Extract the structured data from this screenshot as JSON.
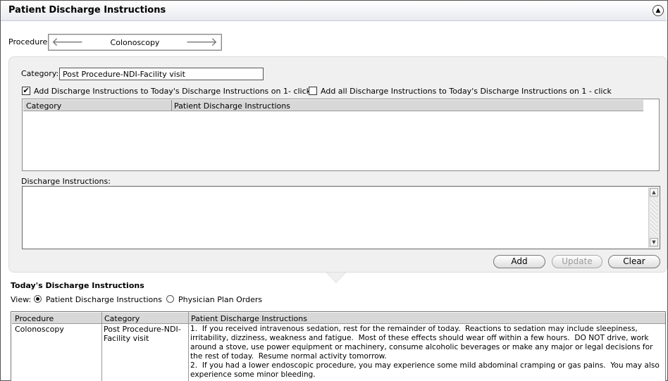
{
  "window": {
    "title": "Patient Discharge Instructions",
    "collapse_icon": "chevron-up-icon"
  },
  "procedure": {
    "label": "Procedure:",
    "value": "Colonoscopy",
    "prev_icon": "arrow-left-icon",
    "next_icon": "arrow-right-icon"
  },
  "category": {
    "label": "Category:",
    "value": "Post Procedure-NDI-Facility visit"
  },
  "options": {
    "add_today": {
      "label": "Add Discharge Instructions to Today's Discharge Instructions on 1- click",
      "checked": true
    },
    "add_all": {
      "label": "Add all Discharge Instructions to Today's Discharge Instructions on 1 - click",
      "checked": false
    }
  },
  "instructions_grid": {
    "columns": [
      "Category",
      "Patient Discharge Instructions"
    ],
    "rows": []
  },
  "discharge_instructions": {
    "label": "Discharge Instructions:",
    "value": ""
  },
  "buttons": {
    "add": "Add",
    "update": "Update",
    "clear": "Clear"
  },
  "today": {
    "title": "Today's Discharge Instructions",
    "view_label": "View:",
    "view_options": [
      {
        "label": "Patient Discharge Instructions",
        "selected": true
      },
      {
        "label": "Physician Plan Orders",
        "selected": false
      }
    ],
    "columns": [
      "Procedure",
      "Category",
      "Patient Discharge Instructions"
    ],
    "rows": [
      {
        "procedure": "Colonoscopy",
        "category": "Post Procedure-NDI-Facility visit",
        "instructions": "1.  If you received intravenous sedation, rest for the remainder of today.  Reactions to sedation may include sleepiness, irritability, dizziness, weakness and fatigue.  Most of these effects should wear off within a few hours.  DO NOT drive, work around a stove, use power equipment or machinery, consume alcoholic beverages or make any major or legal decisions for the rest of today.  Resume normal activity tomorrow.\n2.  If you had a lower endoscopic procedure, you may experience some mild abdominal cramping or gas pains.  You may also experience some minor bleeding."
      }
    ]
  }
}
